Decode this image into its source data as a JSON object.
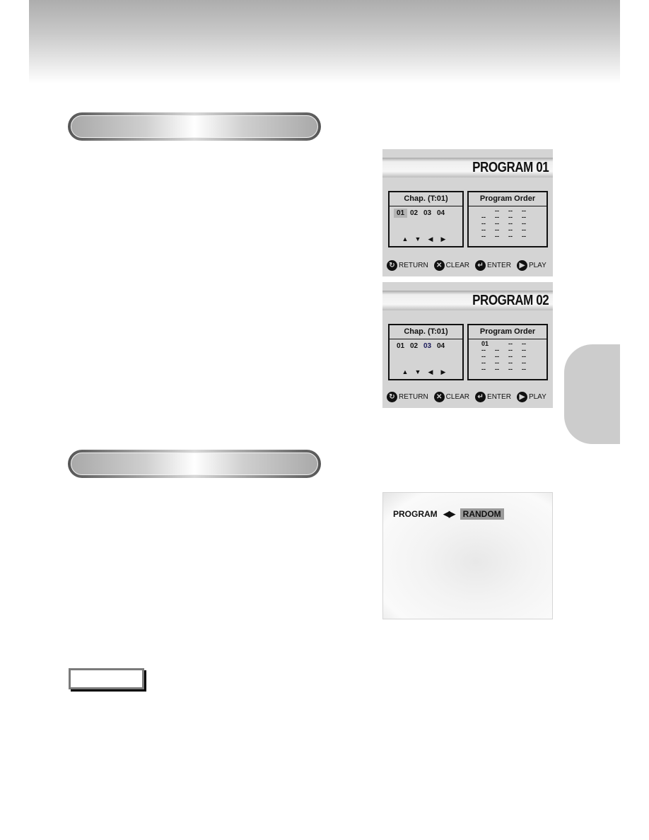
{
  "page": {
    "section_titles": [
      "",
      ""
    ],
    "note_label": ""
  },
  "screens": [
    {
      "title": "PROGRAM  01",
      "chap_header": "Chap.  (T:01)",
      "chapters": [
        "01",
        "02",
        "03",
        "04"
      ],
      "selected_chapter": "01",
      "order_header": "Program Order",
      "order_cells": [
        "",
        "--",
        "--",
        "--",
        "--",
        "--",
        "--",
        "--",
        "--",
        "--",
        "--",
        "--",
        "--",
        "--",
        "--",
        "--",
        "--",
        "--",
        "--",
        "--"
      ],
      "nav_arrows": [
        "▲",
        "▼",
        "◀",
        "▶"
      ],
      "footer": [
        {
          "icon": "return-icon",
          "glyph": "↻",
          "label": "RETURN"
        },
        {
          "icon": "clear-icon",
          "glyph": "✕",
          "label": "CLEAR"
        },
        {
          "icon": "enter-icon",
          "glyph": "↵",
          "label": "ENTER"
        },
        {
          "icon": "play-icon",
          "glyph": "▶",
          "label": "PLAY"
        }
      ]
    },
    {
      "title": "PROGRAM  02",
      "chap_header": "Chap.  (T:01)",
      "chapters": [
        "01",
        "02",
        "03",
        "04"
      ],
      "selected_chapter": "03",
      "order_header": "Program Order",
      "order_cells": [
        "01",
        "",
        "--",
        "--",
        "--",
        "--",
        "--",
        "--",
        "--",
        "--",
        "--",
        "--",
        "--",
        "--",
        "--",
        "--",
        "--",
        "--",
        "--",
        "--"
      ],
      "nav_arrows": [
        "▲",
        "▼",
        "◀",
        "▶"
      ],
      "footer": [
        {
          "icon": "return-icon",
          "glyph": "↻",
          "label": "RETURN"
        },
        {
          "icon": "clear-icon",
          "glyph": "✕",
          "label": "CLEAR"
        },
        {
          "icon": "enter-icon",
          "glyph": "↵",
          "label": "ENTER"
        },
        {
          "icon": "play-icon",
          "glyph": "▶",
          "label": "PLAY"
        }
      ]
    }
  ],
  "random_screen": {
    "label": "PROGRAM",
    "arrows": "◀▶",
    "option": "RANDOM"
  }
}
